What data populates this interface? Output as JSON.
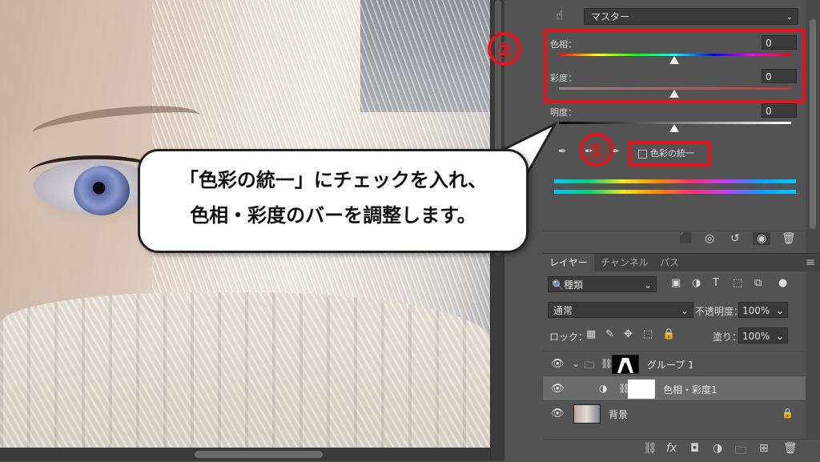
{
  "properties": {
    "preset": "マスター",
    "hue_label": "色相：",
    "hue_value": "0",
    "saturation_label": "彩度：",
    "saturation_value": "0",
    "lightness_label": "明度：",
    "lightness_value": "0",
    "colorize_label": "色彩の統一",
    "colorize_checked": false
  },
  "annotations": {
    "marker_1": "①",
    "marker_2": "②",
    "highlight_color": "#e8121c"
  },
  "callout": {
    "line1": "「色彩の統一」にチェックを入れ、",
    "line2": "色相・彩度のバーを調整します。"
  },
  "layers_panel": {
    "tabs": [
      "レイヤー",
      "チャンネル",
      "パス"
    ],
    "active_tab": "レイヤー",
    "filter_label": "種類",
    "blend_mode": "通常",
    "opacity_label": "不透明度：",
    "opacity_value": "100%",
    "lock_label": "ロック：",
    "fill_label": "塗り：",
    "fill_value": "100%",
    "layers": [
      {
        "name": "グループ 1",
        "type": "group"
      },
      {
        "name": "色相・彩度1",
        "type": "adjustment",
        "selected": true
      },
      {
        "name": "背景",
        "type": "background",
        "locked": true
      }
    ]
  },
  "icons": {
    "filter_icons": [
      "image-filter-icon",
      "adjustment-filter-icon",
      "text-filter-icon",
      "shape-filter-icon",
      "smartobject-filter-icon",
      "toggle-filter-icon"
    ],
    "lock_icons": [
      "lock-transparent-icon",
      "lock-paint-icon",
      "lock-move-icon",
      "lock-artboard-icon",
      "lock-all-icon"
    ],
    "properties_footer": [
      "clip-to-layer-icon",
      "view-previous-icon",
      "reset-icon",
      "visibility-icon",
      "delete-icon"
    ],
    "layers_footer": [
      "link-icon",
      "fx-icon",
      "mask-icon",
      "adjustment-icon",
      "folder-icon",
      "new-layer-icon",
      "trash-icon"
    ]
  }
}
